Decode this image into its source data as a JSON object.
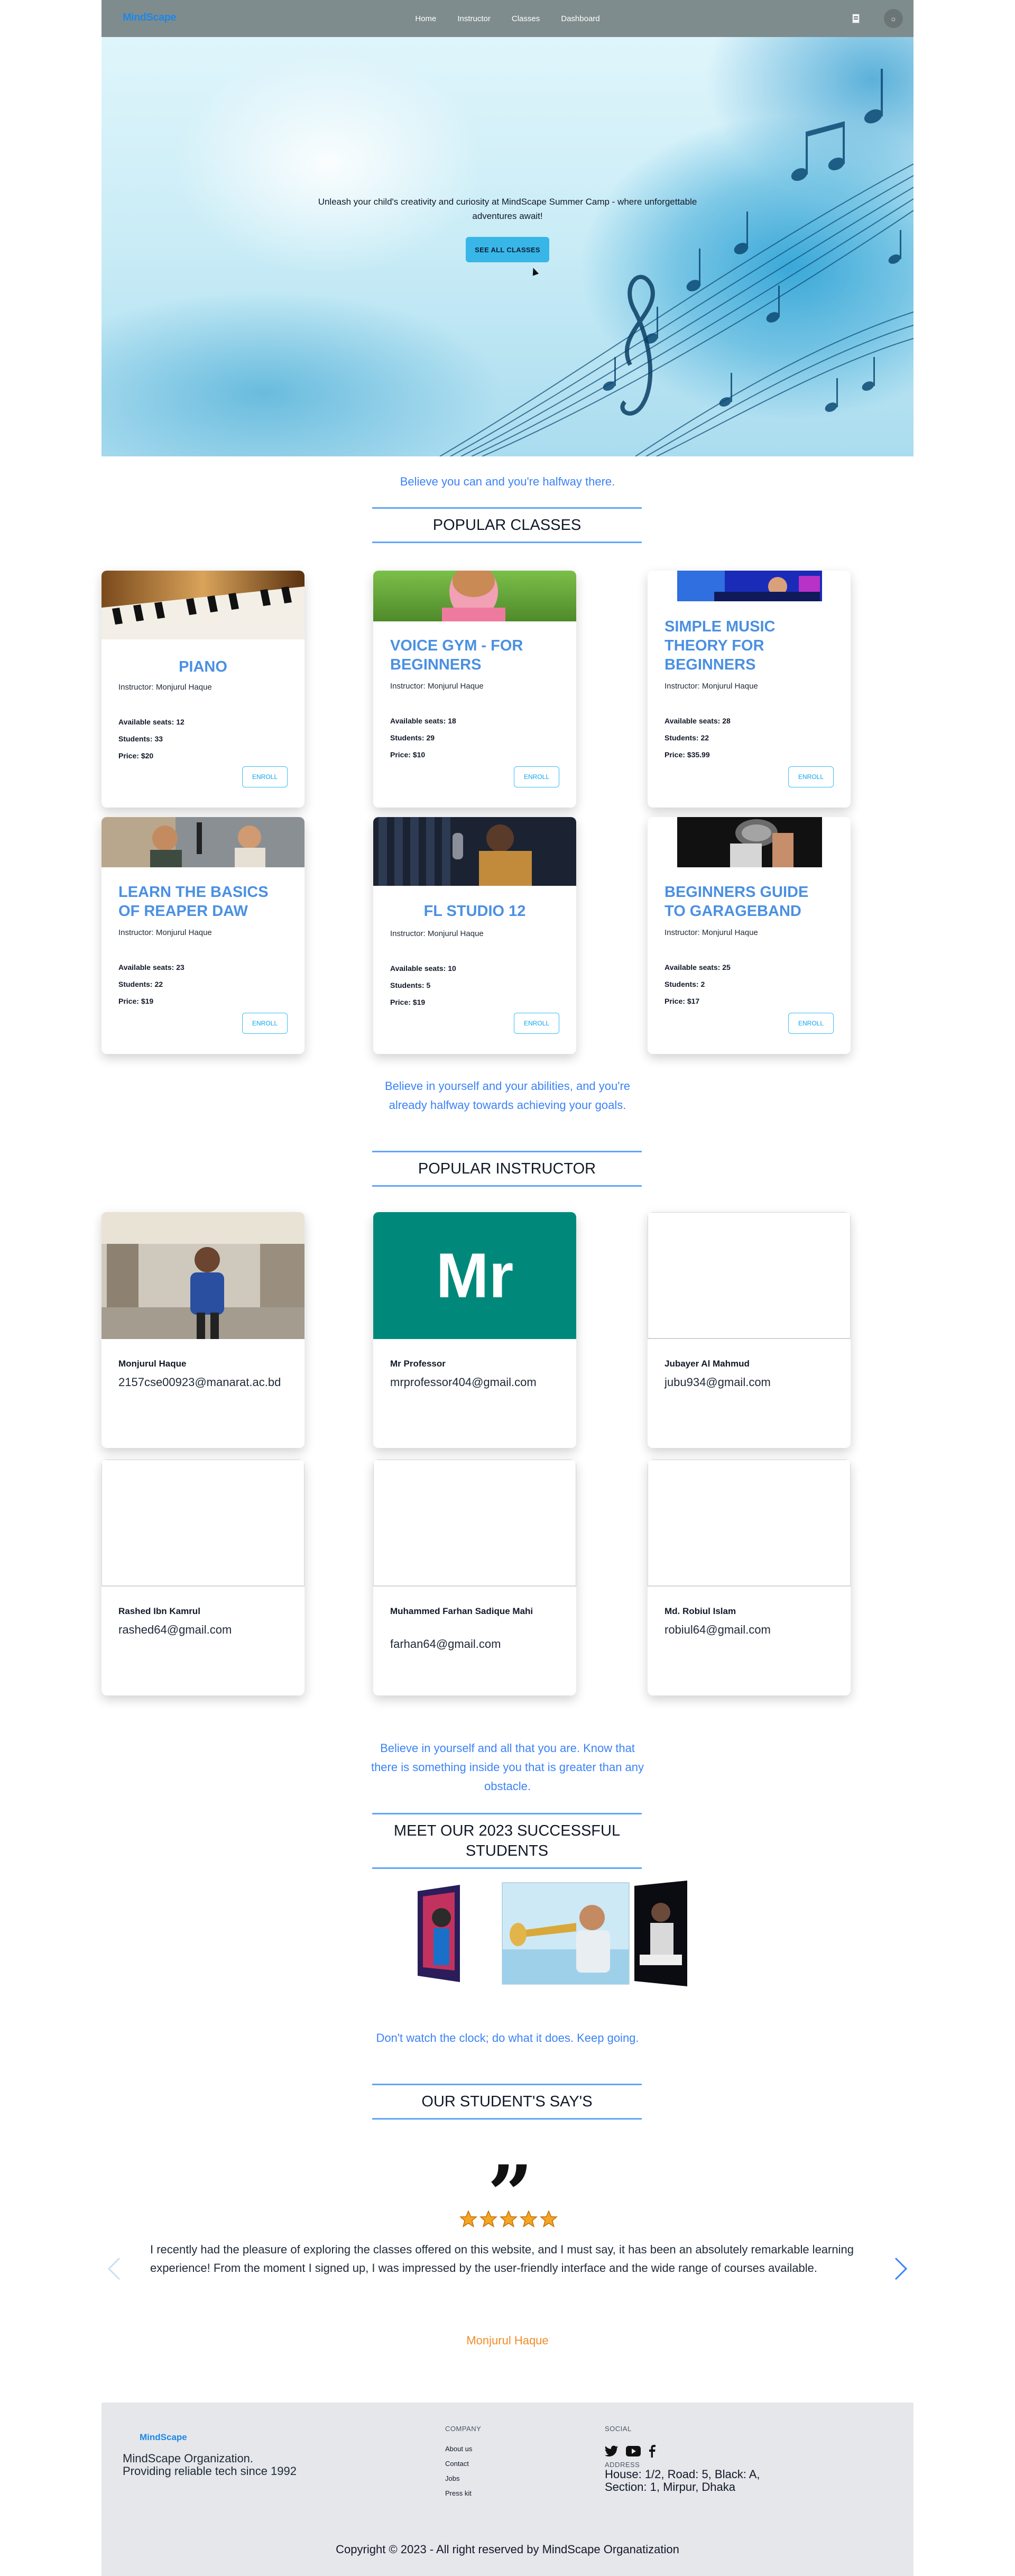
{
  "navbar": {
    "logo": "MindScape",
    "links": [
      "Home",
      "Instructor",
      "Classes",
      "Dashboard"
    ]
  },
  "hero": {
    "tagline": "Unleash your child's creativity and curiosity at MindScape Summer Camp - where unforgettable adventures await!",
    "button": "SEE ALL CLASSES"
  },
  "classes_section": {
    "quote": "Believe you can and you're halfway there.",
    "title": "POPULAR CLASSES",
    "seats_label": "Available seats:",
    "students_label": "Students:",
    "price_label": "Price:",
    "enroll_label": "ENROLL",
    "cards": [
      {
        "title": "Piano",
        "instructor": "Instructor: Monjurul Haque",
        "seats": "12",
        "students": "33",
        "price": "$20"
      },
      {
        "title": "Voice Gym - For Beginners",
        "instructor": "Instructor: Monjurul Haque",
        "seats": "18",
        "students": "29",
        "price": "$10"
      },
      {
        "title": "Simple Music Theory for Beginners",
        "instructor": "Instructor: Monjurul Haque",
        "seats": "28",
        "students": "22",
        "price": "$35.99"
      },
      {
        "title": "Learn the basics of Reaper DAW",
        "instructor": "Instructor: Monjurul Haque",
        "seats": "23",
        "students": "22",
        "price": "$19"
      },
      {
        "title": "FL Studio 12",
        "instructor": "Instructor: Monjurul Haque",
        "seats": "10",
        "students": "5",
        "price": "$19"
      },
      {
        "title": "Beginners Guide to GarageBand",
        "instructor": "Instructor: Monjurul Haque",
        "seats": "25",
        "students": "2",
        "price": "$17"
      }
    ]
  },
  "instructors_section": {
    "quote": "Believe in yourself and your abilities, and you're already halfway towards achieving your goals.",
    "title": "POPULAR INSTRUCTOR",
    "mr_avatar_text": "Mr",
    "cards": [
      {
        "name": "Monjurul Haque",
        "email": "2157cse00923@manarat.ac.bd"
      },
      {
        "name": "Mr Professor",
        "email": "mrprofessor404@gmail.com"
      },
      {
        "name": "Jubayer Al Mahmud",
        "email": "jubu934@gmail.com"
      },
      {
        "name": "Rashed Ibn Kamrul",
        "email": "rashed64@gmail.com"
      },
      {
        "name": "Muhammed Farhan Sadique Mahi",
        "email": "farhan64@gmail.com"
      },
      {
        "name": "Md. Robiul Islam",
        "email": "robiul64@gmail.com"
      }
    ]
  },
  "students_section": {
    "quote": "Believe in yourself and all that you are. Know that there is something inside you that is greater than any obstacle.",
    "title": "MEET OUR 2023 SUCCESSFUL STUDENTS"
  },
  "reviews_section": {
    "quote": "Don't watch the clock; do what it does. Keep going.",
    "title": "OUR STUDENT'S SAY'S",
    "rating": 5,
    "review": "I recently had the pleasure of exploring the classes offered on this website, and I must say, it has been an absolutely remarkable learning experience! From the moment I signed up, I was impressed by the user-friendly interface and the wide range of courses available.",
    "reviewer": "Monjurul Haque"
  },
  "footer": {
    "logo": "MindScape",
    "org_line1": "MindScape Organization.",
    "org_line2": "Providing reliable tech since 1992",
    "company_heading": "COMPANY",
    "company_links": [
      "About us",
      "Contact",
      "Jobs",
      "Press kit"
    ],
    "social_heading": "SOCIAL",
    "address_heading": "ADDRESS",
    "address_line1": "House: 1/2, Road: 5, Black: A,",
    "address_line2": "Section: 1, Mirpur, Dhaka",
    "copyright": "Copyright © 2023 - All right reserved by MindScape Organatization"
  },
  "colors": {
    "accent": "#4a90e2",
    "button": "#38b6e8",
    "reviewer": "#f28c28",
    "navbar": "#7f8c8d"
  }
}
